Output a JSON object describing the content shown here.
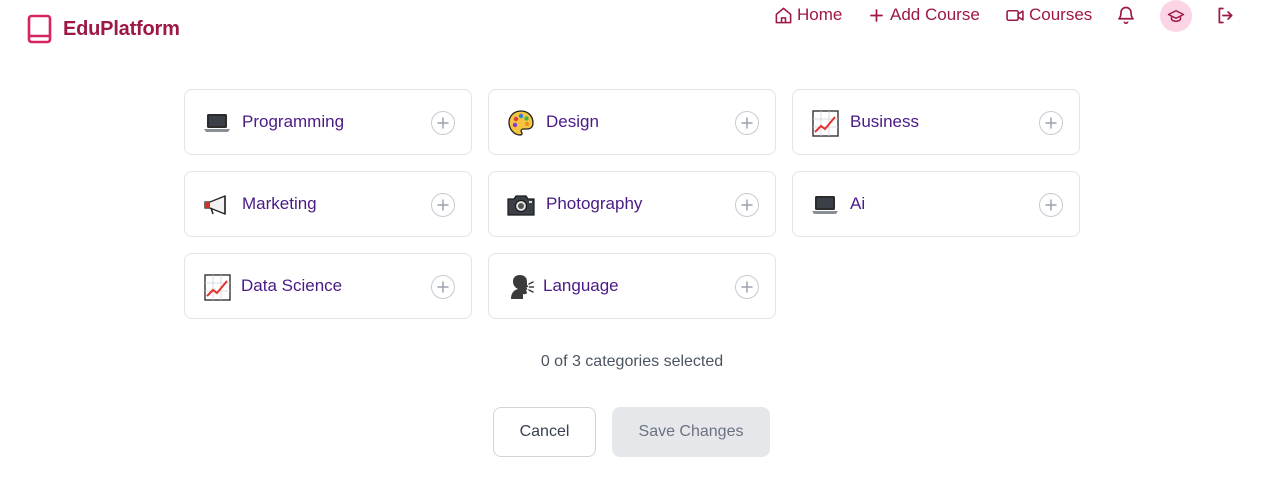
{
  "brand": {
    "name": "EduPlatform",
    "icon": "book-icon"
  },
  "nav": {
    "home_label": "Home",
    "add_course_label": "Add Course",
    "courses_label": "Courses",
    "bell_icon": "bell-icon",
    "avatar_icon": "graduation-cap-icon",
    "logout_icon": "logout-icon"
  },
  "categories": [
    {
      "label": "Programming",
      "icon": "laptop-icon"
    },
    {
      "label": "Design",
      "icon": "palette-icon"
    },
    {
      "label": "Business",
      "icon": "chart-increasing-icon"
    },
    {
      "label": "Marketing",
      "icon": "megaphone-icon"
    },
    {
      "label": "Photography",
      "icon": "camera-icon"
    },
    {
      "label": "Ai",
      "icon": "laptop-icon"
    },
    {
      "label": "Data Science",
      "icon": "chart-increasing-icon"
    },
    {
      "label": "Language",
      "icon": "speaking-head-icon"
    }
  ],
  "selection": {
    "status_text": "0 of 3 categories selected",
    "selected_count": 0,
    "max_count": 3
  },
  "actions": {
    "cancel_label": "Cancel",
    "save_label": "Save Changes"
  },
  "colors": {
    "brand": "#9d1845",
    "category_text": "#4a1a86",
    "avatar_bg": "#fbd5e5",
    "disabled_button": "#e5e7eb"
  }
}
